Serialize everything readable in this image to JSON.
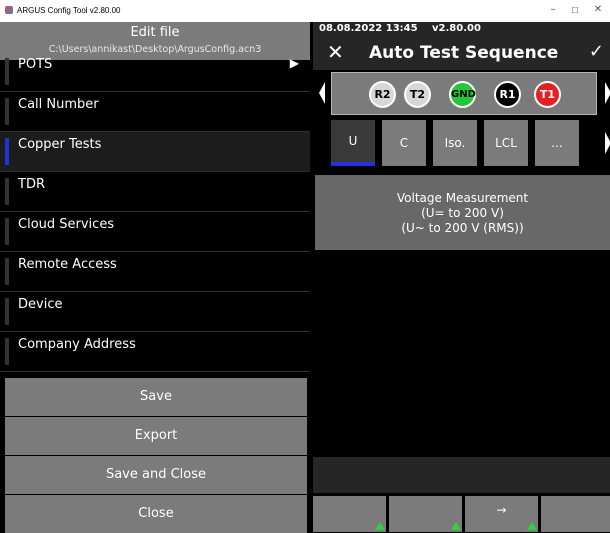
{
  "window": {
    "title": "ARGUS Config Tool v2.80.00",
    "min_icon": "minimize-icon",
    "max_icon": "maximize-icon",
    "close_icon": "close-icon"
  },
  "left": {
    "heading": "Edit file",
    "path": "C:\\Users\\annikast\\Desktop\\ArgusConfig.acn3",
    "menu": [
      {
        "label": "POTS"
      },
      {
        "label": "Call Number"
      },
      {
        "label": "Copper Tests"
      },
      {
        "label": "TDR"
      },
      {
        "label": "Cloud Services"
      },
      {
        "label": "Remote Access"
      },
      {
        "label": "Device"
      },
      {
        "label": "Company Address"
      }
    ],
    "active_item": "Copper Tests",
    "buttons": {
      "save": "Save",
      "export": "Export",
      "save_close": "Save and Close",
      "close": "Close"
    }
  },
  "right": {
    "datetime": "08.08.2022 13:45",
    "version": "v2.80.00",
    "title": "Auto Test Sequence",
    "close_glyph": "✕",
    "confirm_glyph": "✓",
    "pins": [
      {
        "label": "R2",
        "color": "#d7d7d7",
        "text": "#000000"
      },
      {
        "label": "T2",
        "color": "#d7d7d7",
        "text": "#000000"
      },
      {
        "label": "GND",
        "color": "#22c73a",
        "text": "#000000"
      },
      {
        "label": "R1",
        "color": "#000000",
        "text": "#ffffff"
      },
      {
        "label": "T1",
        "color": "#e62020",
        "text": "#ffffff"
      }
    ],
    "tabs": [
      {
        "label": "U"
      },
      {
        "label": "C"
      },
      {
        "label": "Iso."
      },
      {
        "label": "LCL"
      },
      {
        "label": "..."
      }
    ],
    "active_tab": "U",
    "measurement": {
      "line1": "Voltage Measurement",
      "line2": "(U= to 200 V)",
      "line3": "(U~ to 200 V (RMS))"
    },
    "softkeys": {
      "key3_label": "→"
    }
  },
  "colors": {
    "accent_blue": "#2430d8",
    "panel_gray": "#7b7b7b"
  }
}
